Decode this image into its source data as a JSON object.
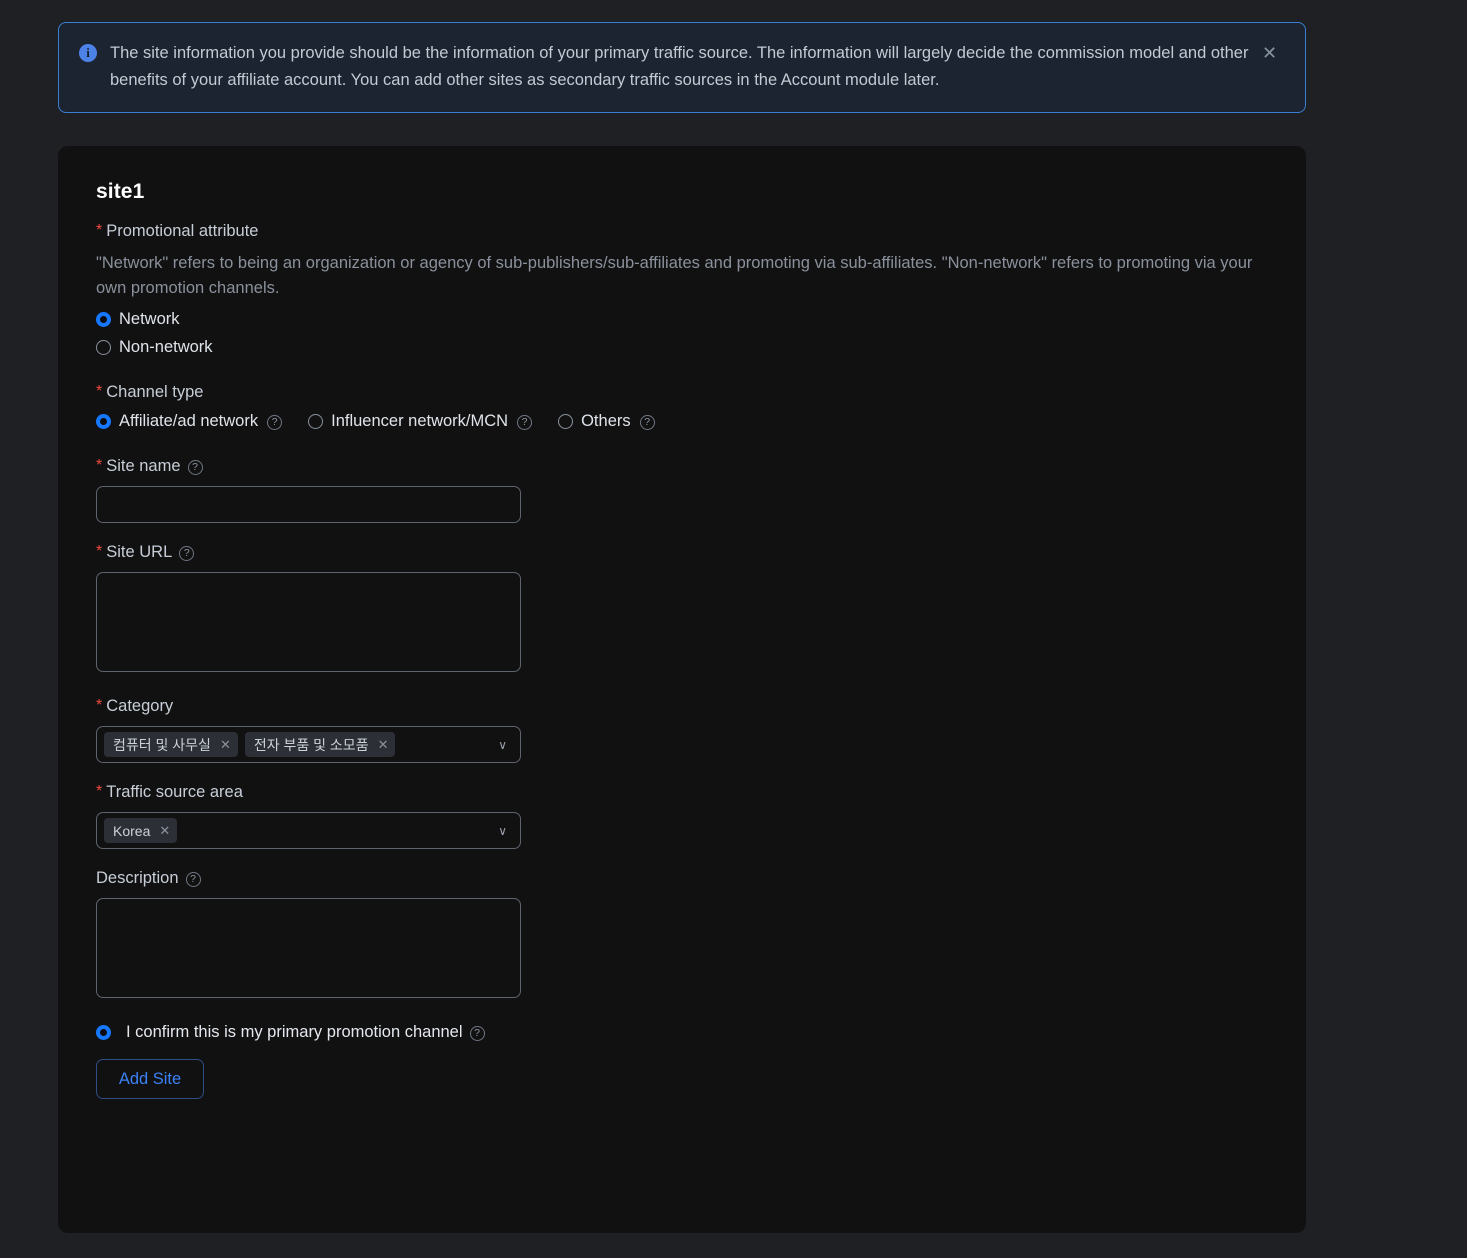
{
  "banner": {
    "icon": "info-icon",
    "text": "The site information you provide should be the information of your primary traffic source. The information will largely decide the commission model and other benefits of your affiliate account. You can add other sites as secondary traffic sources in the Account module later.",
    "close_label": "✕"
  },
  "card": {
    "title": "site1",
    "promotional_attribute": {
      "label": "Promotional attribute",
      "required_mark": "*",
      "helper": "\"Network\" refers to being an organization or agency of sub-publishers/sub-affiliates and promoting via sub-affiliates. \"Non-network\" refers to promoting via your own promotion channels.",
      "options": [
        {
          "label": "Network",
          "selected": true
        },
        {
          "label": "Non-network",
          "selected": false
        }
      ]
    },
    "channel_type": {
      "label": "Channel type",
      "required_mark": "*",
      "options": [
        {
          "label": "Affiliate/ad network",
          "selected": true,
          "help": "?"
        },
        {
          "label": "Influencer network/MCN",
          "selected": false,
          "help": "?"
        },
        {
          "label": "Others",
          "selected": false,
          "help": "?"
        }
      ]
    },
    "site_name": {
      "label": "Site name",
      "required_mark": "*",
      "help": "?",
      "value": "",
      "placeholder": ""
    },
    "site_url": {
      "label": "Site URL",
      "required_mark": "*",
      "help": "?",
      "value": "",
      "placeholder": ""
    },
    "category": {
      "label": "Category",
      "required_mark": "*",
      "tags": [
        "컴퓨터 및 사무실",
        "전자 부품 및 소모품"
      ],
      "tag_remove_label": "✕",
      "chevron": "∨"
    },
    "traffic_source_area": {
      "label": "Traffic source area",
      "required_mark": "*",
      "tags": [
        "Korea"
      ],
      "tag_remove_label": "✕",
      "chevron": "∨"
    },
    "description": {
      "label": "Description",
      "help": "?",
      "value": "",
      "placeholder": ""
    },
    "confirm": {
      "label": "I confirm this is my primary promotion channel",
      "checked": true,
      "help": "?"
    },
    "add_site_button": "Add Site"
  },
  "colors": {
    "page_background": "#1e2024",
    "card_background": "#111111",
    "accent_blue": "#1677ff",
    "banner_border": "#3b7fd4",
    "required_red": "#f04a3f",
    "link_blue": "#3b82f6"
  }
}
